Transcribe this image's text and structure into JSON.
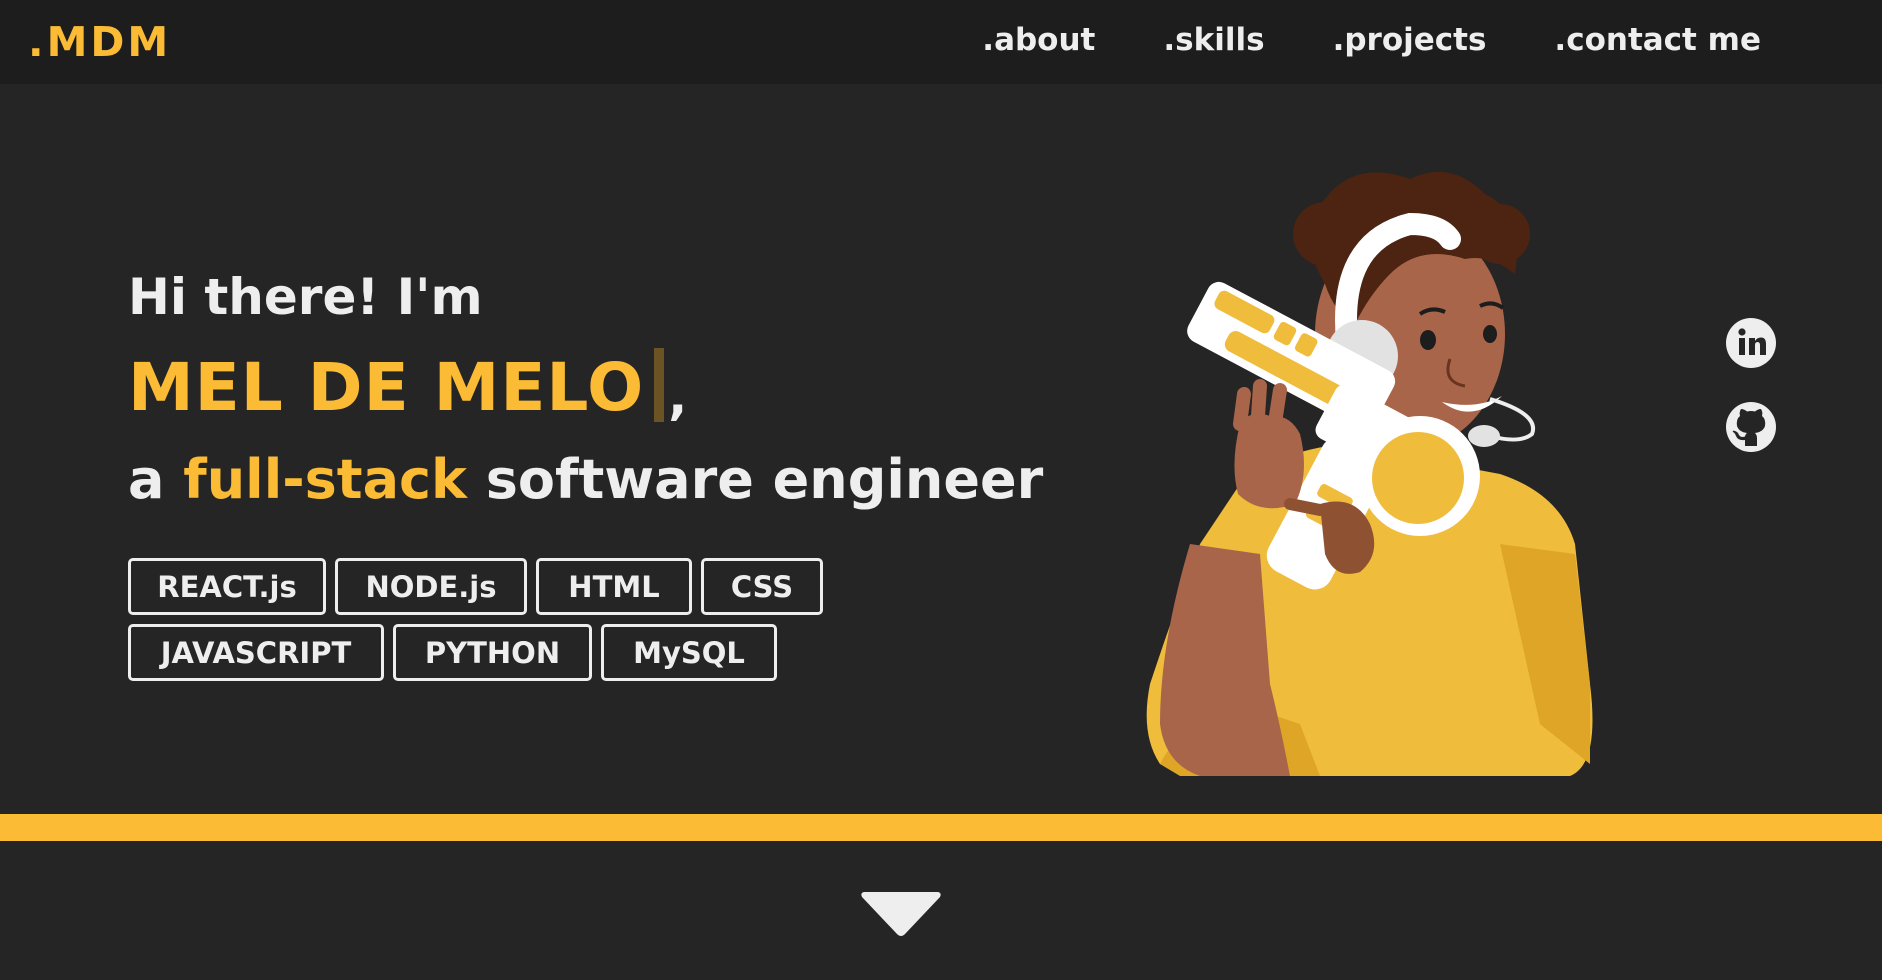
{
  "navbar": {
    "logo": ".MDM",
    "links": [
      {
        "label": ".about"
      },
      {
        "label": ".skills"
      },
      {
        "label": ".projects"
      },
      {
        "label": ".contact me"
      }
    ]
  },
  "hero": {
    "greeting": "Hi there! I'm",
    "name": "MEL DE MELO",
    "name_suffix": ",",
    "role_prefix": "a ",
    "role_accent": "full-stack",
    "role_suffix": " software engineer",
    "skills_row1": [
      "REACT.js",
      "NODE.js",
      "HTML",
      "CSS"
    ],
    "skills_row2": [
      "JAVASCRIPT",
      "PYTHON",
      "MySQL"
    ],
    "illustration_icon": "person-with-headset-and-toy-blaster-illustration"
  },
  "socials": [
    {
      "icon": "linkedin-icon"
    },
    {
      "icon": "github-icon"
    }
  ],
  "scroll": {
    "icon": "chevron-down-icon"
  },
  "colors": {
    "background": "#252525",
    "navbar": "#1d1d1d",
    "accent": "#fbbb35",
    "text": "#eeeeee"
  }
}
